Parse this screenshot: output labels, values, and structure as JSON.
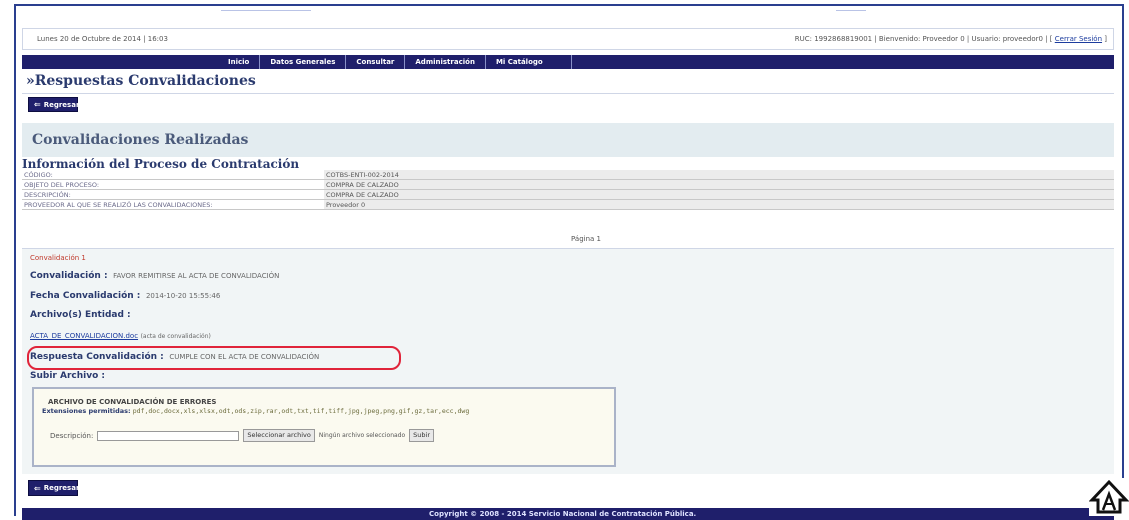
{
  "header": {
    "date": "Lunes 20 de Octubre de 2014 | 16:03",
    "user_info": "RUC: 1992868819001 | Bienvenido: Proveedor 0 | Usuario: proveedor0 | [",
    "logout": "Cerrar Sesión",
    "logout_suffix": "]"
  },
  "nav": {
    "items": [
      "Inicio",
      "Datos Generales",
      "Consultar",
      "Administración",
      "Mi Catálogo"
    ]
  },
  "page": {
    "title": "»Respuestas Convalidaciones",
    "back_label": "Regresar",
    "section_title": "Convalidaciones Realizadas",
    "subtitle": "Información del Proceso de Contratación"
  },
  "process_info": [
    {
      "label": "CÓDIGO:",
      "value": "COTBS-ENTI-002-2014"
    },
    {
      "label": "OBJETO DEL PROCESO:",
      "value": "COMPRA DE CALZADO"
    },
    {
      "label": "DESCRIPCIÓN:",
      "value": "COMPRA DE CALZADO"
    },
    {
      "label": "PROVEEDOR AL QUE SE REALIZÓ LAS CONVALIDACIONES:",
      "value": "Proveedor 0"
    }
  ],
  "pagination": {
    "label": "Página 1"
  },
  "convalidacion": {
    "heading": "Convalidación 1",
    "conv_label": "Convalidación :",
    "conv_value": "FAVOR REMITIRSE AL ACTA DE CONVALIDACIÓN",
    "fecha_label": "Fecha Convalidación :",
    "fecha_value": "2014-10-20 15:55:46",
    "archivos_label": "Archivo(s) Entidad :",
    "file_link": "ACTA_DE_CONVALIDACION.doc",
    "file_desc": "(acta de convalidación)",
    "respuesta_label": "Respuesta Convalidación :",
    "respuesta_value": "CUMPLE CON EL ACTA DE CONVALIDACIÓN",
    "subir_label": "Subir Archivo :"
  },
  "upload": {
    "title": "ARCHIVO DE CONVALIDACIÓN DE ERRORES",
    "ext_label": "Extensiones permitidas:",
    "extensions": "pdf,doc,docx,xls,xlsx,odt,ods,zip,rar,odt,txt,tif,tiff,jpg,jpeg,png,gif,gz,tar,ecc,dwg",
    "desc_label": "Descripción:",
    "desc_value": "",
    "select_btn": "Seleccionar archivo",
    "no_file": "Ningún archivo seleccionado",
    "upload_btn": "Subir"
  },
  "footer": {
    "text": "Copyright © 2008 - 2014 Servicio Nacional de Contratación Pública."
  },
  "colors": {
    "nav_bg": "#1f1f6b",
    "highlight": "#e0243a",
    "title": "#2a3a6e"
  }
}
